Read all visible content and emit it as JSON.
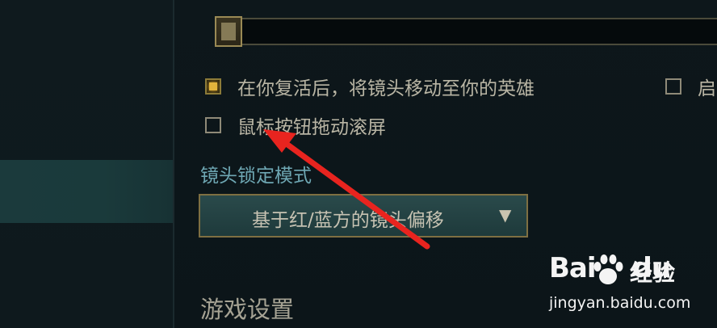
{
  "options": {
    "revive_camera": {
      "label": "在你复活后，将镜头移动至你的英雄",
      "checked": true
    },
    "right_option": {
      "label": "启",
      "checked": false
    },
    "mouse_drag_scroll": {
      "label": "鼠标按钮拖动滚屏",
      "checked": false
    }
  },
  "camera_lock": {
    "label": "镜头锁定模式",
    "selected": "基于红/蓝方的镜头偏移",
    "arrow": "▼"
  },
  "section": {
    "game_settings_heading": "游戏设置"
  },
  "watermark": {
    "logo_left": "Bai",
    "logo_right": "du",
    "brand": "经验",
    "url": "jingyan.baidu.com"
  },
  "colors": {
    "accent_gold": "#e3b43c",
    "annotation_red": "#e8241f",
    "section_label": "#6ea7b3"
  }
}
